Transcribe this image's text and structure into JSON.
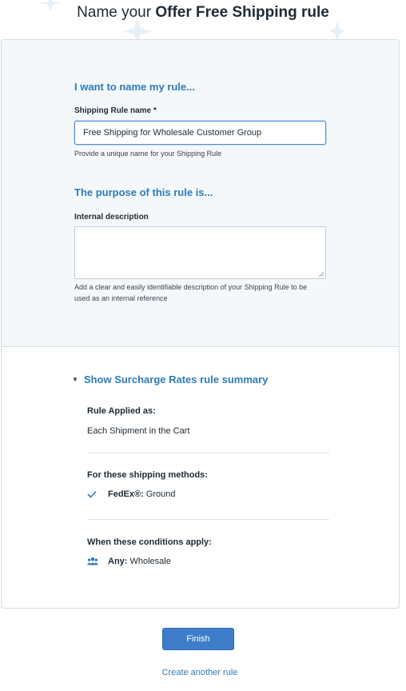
{
  "page": {
    "title_prefix": "Name your ",
    "title_bold": "Offer Free Shipping rule"
  },
  "name_section": {
    "heading": "I want to name my rule...",
    "field_label": "Shipping Rule name *",
    "field_value": "Free Shipping for Wholesale Customer Group",
    "help_text": "Provide a unique name for your Shipping Rule"
  },
  "purpose_section": {
    "heading": "The purpose of this rule is...",
    "field_label": "Internal description",
    "field_value": "",
    "help_text": "Add a clear and easily identifiable description of your Shipping Rule to be used as an internal reference"
  },
  "summary": {
    "toggle_label": "Show Surcharge Rates rule summary",
    "applied_label": "Rule Applied as:",
    "applied_value": "Each Shipment in the Cart",
    "methods_label": "For these shipping methods:",
    "method_carrier": "FedEx®:",
    "method_service": "Ground",
    "conditions_label": "When these conditions apply:",
    "condition_scope": "Any:",
    "condition_value": "Wholesale"
  },
  "actions": {
    "finish_label": "Finish",
    "create_another_label": "Create another rule"
  },
  "colors": {
    "accent": "#2e7bb7",
    "primary_button": "#3d7dc9",
    "panel_background": "#f4f8fb"
  },
  "icons": {
    "method": "check-icon",
    "condition": "customer-group-icon",
    "toggle": "caret-down-icon"
  }
}
